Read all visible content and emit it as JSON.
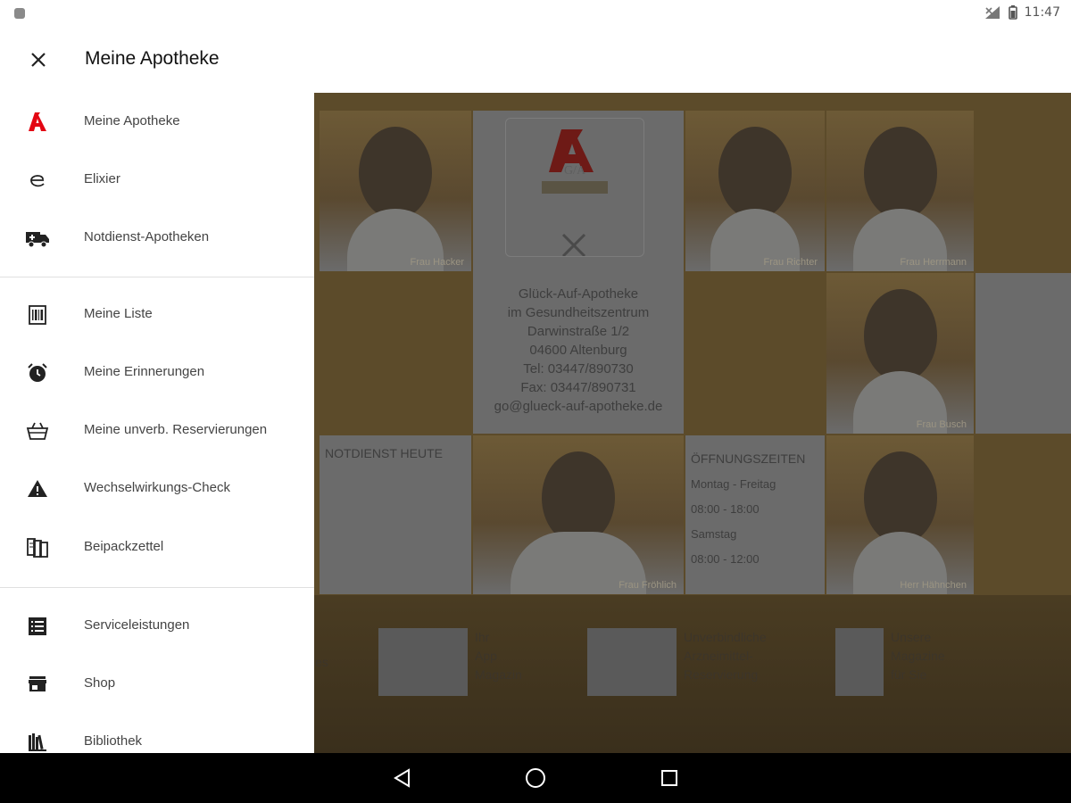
{
  "status": {
    "time": "11:47"
  },
  "appbar": {
    "title": "Meine Apotheke",
    "close_icon": "close-icon"
  },
  "drawer": {
    "groups": [
      [
        {
          "label": "Meine Apotheke",
          "icon": "pharmacy-a-icon"
        },
        {
          "label": "Elixier",
          "icon": "elixier-e-icon"
        },
        {
          "label": "Notdienst-Apotheken",
          "icon": "ambulance-icon"
        }
      ],
      [
        {
          "label": "Meine Liste",
          "icon": "list-barcode-icon"
        },
        {
          "label": "Meine Erinnerungen",
          "icon": "alarm-clock-icon"
        },
        {
          "label": "Meine unverb. Reservierungen",
          "icon": "basket-icon"
        },
        {
          "label": "Wechselwirkungs-Check",
          "icon": "warning-icon"
        },
        {
          "label": "Beipackzettel",
          "icon": "leaflet-icon"
        }
      ],
      [
        {
          "label": "Serviceleistungen",
          "icon": "service-list-icon"
        },
        {
          "label": "Shop",
          "icon": "store-icon"
        },
        {
          "label": "Bibliothek",
          "icon": "library-icon"
        }
      ]
    ]
  },
  "content": {
    "staff": [
      {
        "caption": "Frau Hacker"
      },
      {
        "caption": "Frau Richter"
      },
      {
        "caption": "Frau Herrmann"
      },
      {
        "caption": "Frau Busch"
      },
      {
        "caption": "Frau Fröhlich"
      },
      {
        "caption": "Herr Hähnchen"
      }
    ],
    "pharmacy": {
      "name": "Glück-Auf-Apotheke",
      "address_lines": [
        "Glück-Auf-Apotheke",
        "im Gesundheitszentrum",
        "Darwinstraße 1/2",
        "04600 Altenburg",
        "Tel: 03447/890730",
        "Fax: 03447/890731",
        "go@glueck-auf-apotheke.de"
      ]
    },
    "notdienst": {
      "title": "NOTDIENST HEUTE"
    },
    "hours": {
      "title": "ÖFFNUNGSZEITEN",
      "rows": [
        "Montag - Freitag",
        "08:00 - 18:00",
        "Samstag",
        "08:00 - 12:00"
      ]
    },
    "promos": [
      {
        "lines": [
          "Ihr",
          "App",
          "Magazin"
        ]
      },
      {
        "lines": [
          "Unverbindliche",
          "Arzneimittel-",
          "Reservierung"
        ]
      },
      {
        "lines": [
          "Unsere",
          "Magazine",
          "für Sie"
        ]
      }
    ],
    "promo_cut": "ies"
  },
  "colors": {
    "accent_red": "#e30613",
    "overlay": "#5c4b2a"
  }
}
